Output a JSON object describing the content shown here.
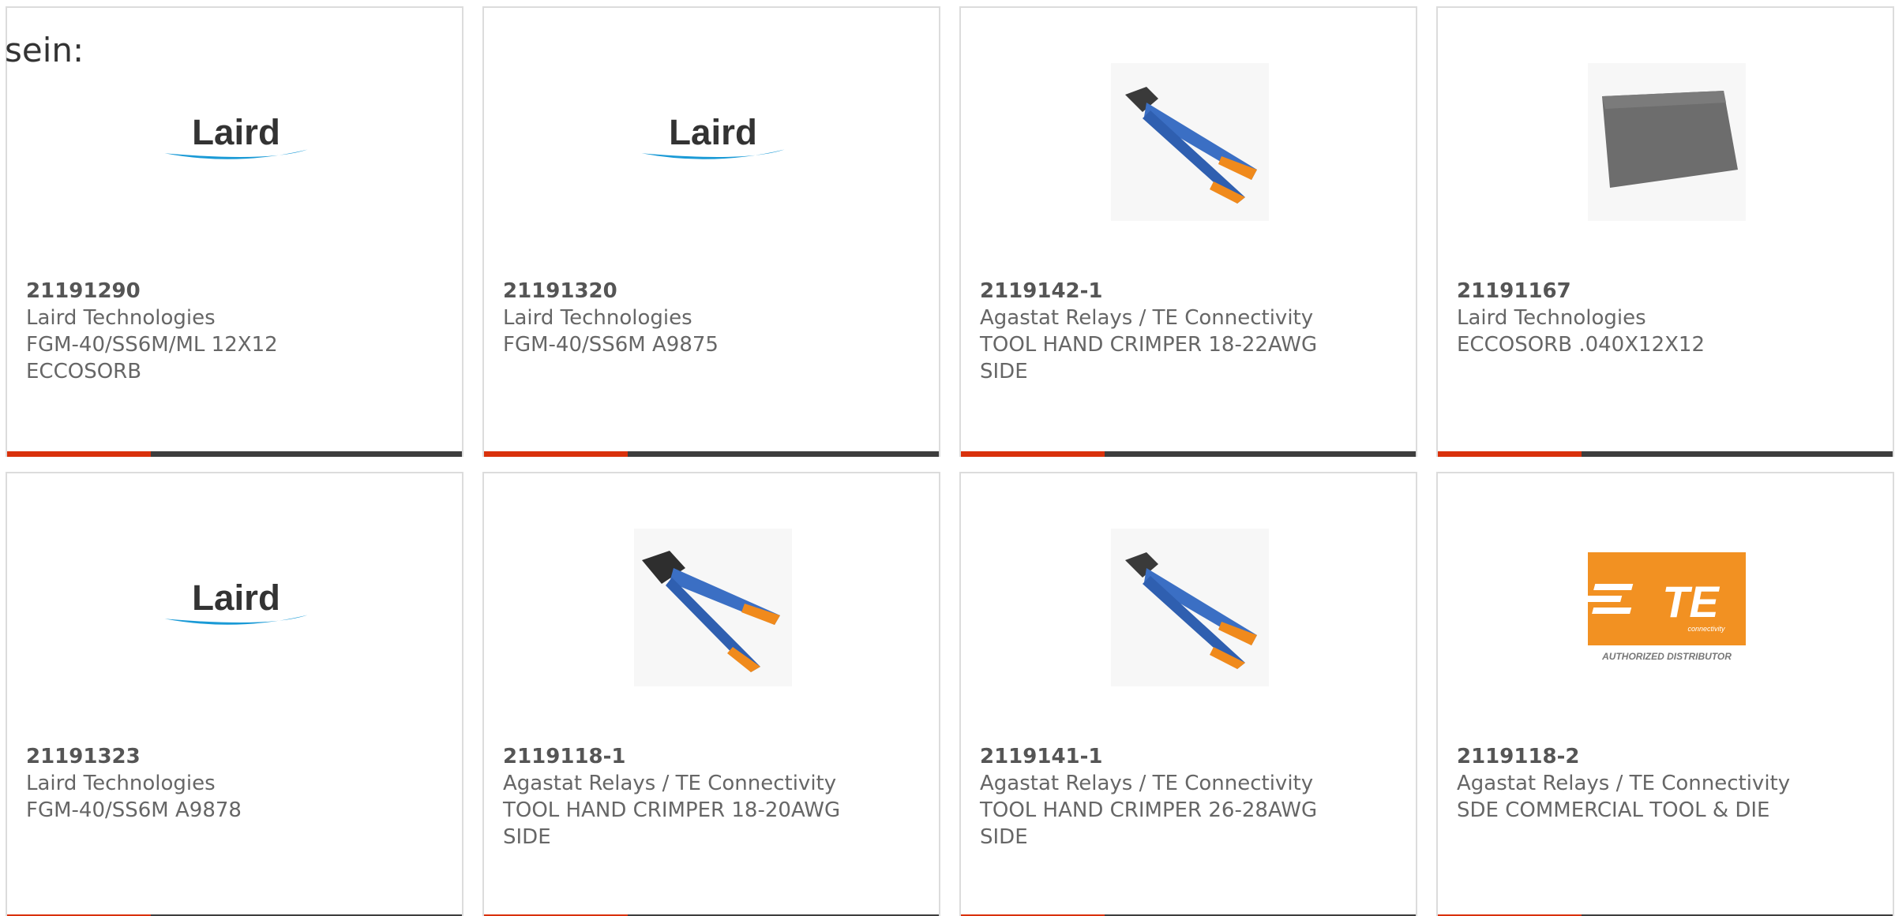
{
  "intro_text": "sein:",
  "products": [
    {
      "part": "21191290",
      "manufacturer": "Laird Technologies",
      "description": "FGM-40/SS6M/ML 12X12\nECCOSORB",
      "image": "laird-logo"
    },
    {
      "part": "21191320",
      "manufacturer": "Laird Technologies",
      "description": "FGM-40/SS6M A9875",
      "image": "laird-logo"
    },
    {
      "part": "2119142-1",
      "manufacturer": "Agastat Relays / TE Connectivity",
      "description": "TOOL HAND CRIMPER 18-22AWG\nSIDE",
      "image": "crimper-tool"
    },
    {
      "part": "21191167",
      "manufacturer": "Laird Technologies",
      "description": "ECCOSORB .040X12X12",
      "image": "absorber-sheet"
    },
    {
      "part": "21191323",
      "manufacturer": "Laird Technologies",
      "description": "FGM-40/SS6M A9878",
      "image": "laird-logo"
    },
    {
      "part": "2119118-1",
      "manufacturer": "Agastat Relays / TE Connectivity",
      "description": "TOOL HAND CRIMPER 18-20AWG\nSIDE",
      "image": "crimper-tool"
    },
    {
      "part": "2119141-1",
      "manufacturer": "Agastat Relays / TE Connectivity",
      "description": "TOOL HAND CRIMPER 26-28AWG\nSIDE",
      "image": "crimper-tool"
    },
    {
      "part": "2119118-2",
      "manufacturer": "Agastat Relays / TE Connectivity",
      "description": "SDE COMMERCIAL TOOL & DIE",
      "image": "te-connectivity-logo"
    }
  ],
  "logos": {
    "laird": "Laird",
    "te": "TE",
    "te_sub": "connectivity",
    "te_authorized": "AUTHORIZED DISTRIBUTOR"
  },
  "colors": {
    "accent": "#d9310b",
    "bar": "#3d3d3d",
    "laird_blue": "#1a9ad6",
    "te_orange": "#f29122",
    "tool_blue": "#3b6fc4",
    "tool_orange": "#f08a1c"
  }
}
